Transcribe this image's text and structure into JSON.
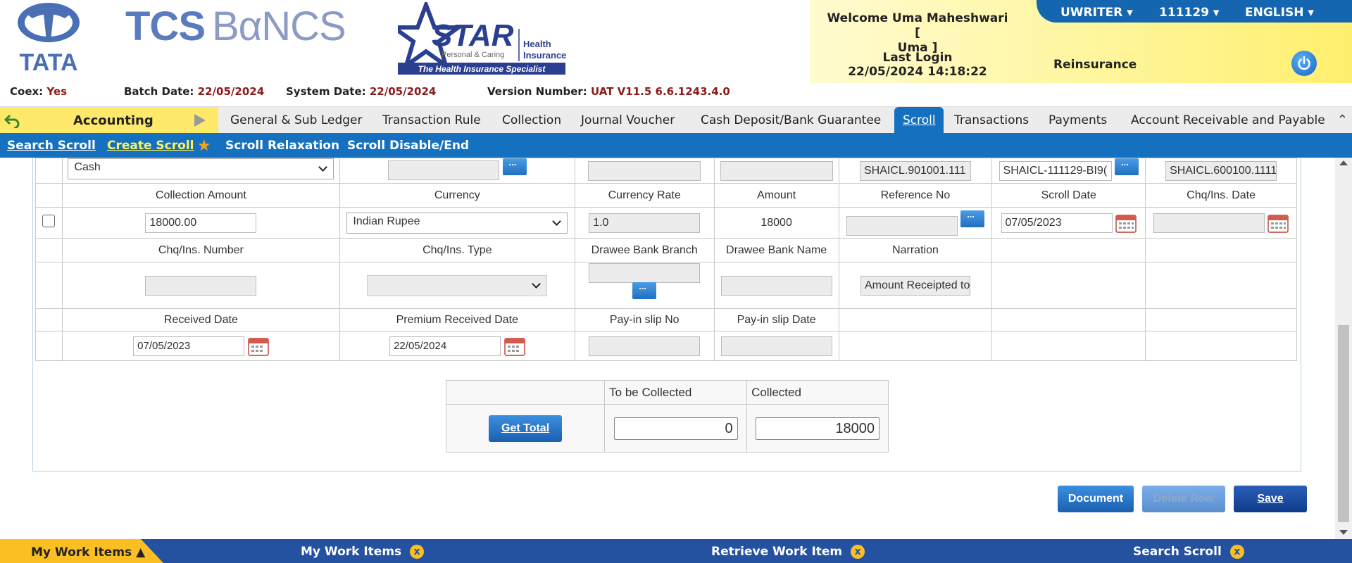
{
  "header": {
    "tata_logo_text": "TATA",
    "tcs_logo": {
      "left": "TCS",
      "right": "BαNCS"
    },
    "star_logo": {
      "name": "STAR",
      "sub": "Personal & Caring",
      "right_top": "Health",
      "right_bottom": "Insurance",
      "tagline": "The Health Insurance Specialist"
    },
    "coex_label": "Coex:",
    "coex_value": "Yes",
    "batch_date_label": "Batch Date:",
    "batch_date_value": "22/05/2024",
    "system_date_label": "System Date:",
    "system_date_value": "22/05/2024",
    "version_label": "Version Number:",
    "version_value": "UAT V11.5 6.6.1243.4.0",
    "welcome_line1": "Welcome Uma Maheshwari [",
    "welcome_line2": "Uma ]",
    "last_login_label": "Last Login",
    "last_login_value": "22/05/2024 14:18:22",
    "module": "Reinsurance",
    "role": "UWRITER ▾",
    "branch": "111129 ▾",
    "language": "ENGLISH ▾"
  },
  "main_nav": {
    "accounting": "Accounting",
    "items": [
      {
        "label": "General & Sub Ledger"
      },
      {
        "label": "Transaction Rule"
      },
      {
        "label": "Collection"
      },
      {
        "label": "Journal Voucher"
      },
      {
        "label": "Cash Deposit/Bank Guarantee"
      },
      {
        "label": "Scroll"
      },
      {
        "label": "Transactions"
      },
      {
        "label": "Payments"
      },
      {
        "label": "Account Receivable and Payable"
      }
    ],
    "collapse": "⌃"
  },
  "sub_nav": {
    "search_scroll": "Search Scroll",
    "create_scroll": "Create Scroll",
    "scroll_relaxation": "Scroll Relaxation",
    "scroll_disable": "Scroll Disable/End"
  },
  "grid": {
    "top_row": {
      "cash_select": "Cash",
      "ref1": "SHAICL.901001.111",
      "ref2": "SHAICL-111129-BI9(",
      "ref3": "SHAICL.600100.1111"
    },
    "headers1": [
      "Collection Amount",
      "Currency",
      "Currency Rate",
      "Amount",
      "Reference No",
      "Scroll Date",
      "Chq/Ins. Date"
    ],
    "row1": {
      "collection_amount": "18000.00",
      "currency": "Indian Rupee",
      "currency_rate": "1.0",
      "amount": "18000",
      "reference_no": "",
      "scroll_date": "07/05/2023",
      "chq_date": ""
    },
    "headers2": [
      "Chq/Ins. Number",
      "Chq/Ins. Type",
      "Drawee Bank Branch",
      "Drawee Bank Name",
      "Narration"
    ],
    "row2": {
      "narration": "Amount Receipted to"
    },
    "headers3": [
      "Received Date",
      "Premium Received Date",
      "Pay-in slip No",
      "Pay-in slip Date"
    ],
    "row3": {
      "received_date": "07/05/2023",
      "premium_received_date": "22/05/2024"
    }
  },
  "totals": {
    "to_be_collected_label": "To be Collected",
    "collected_label": "Collected",
    "get_total": "Get Total",
    "to_be_collected_value": "0",
    "collected_value": "18000"
  },
  "actions": {
    "document": "Document",
    "delete_row": "Delete Row",
    "save": "Save"
  },
  "bottom_bar": {
    "my_work_items_tab": "My Work Items ▲",
    "my_work_items": "My Work Items",
    "retrieve_work_item": "Retrieve Work Item",
    "search_scroll": "Search Scroll",
    "close_glyph": "x"
  }
}
